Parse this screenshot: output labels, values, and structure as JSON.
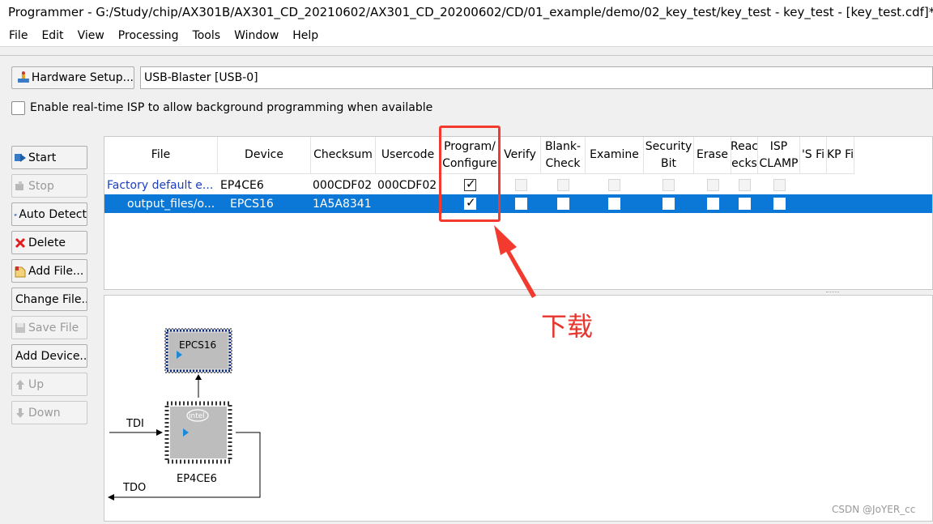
{
  "window": {
    "title": "Programmer - G:/Study/chip/AX301B/AX301_CD_20210602/AX301_CD_20200602/CD/01_example/demo/02_key_test/key_test - key_test - [key_test.cdf]*"
  },
  "menu": [
    "File",
    "Edit",
    "View",
    "Processing",
    "Tools",
    "Window",
    "Help"
  ],
  "hardware": {
    "setup_label": "Hardware Setup...",
    "selected": "USB-Blaster [USB-0]"
  },
  "isp": {
    "label": "Enable real-time ISP to allow background programming when available",
    "checked": false
  },
  "sidebar": {
    "start": "Start",
    "stop": "Stop",
    "auto_detect": "Auto Detect",
    "delete": "Delete",
    "add_file": "Add File...",
    "change_file": "Change File...",
    "save_file": "Save File",
    "add_device": "Add Device...",
    "up": "Up",
    "down": "Down"
  },
  "grid": {
    "columns": [
      "File",
      "Device",
      "Checksum",
      "Usercode",
      "Program/\nConfigure",
      "Verify",
      "Blank-\nCheck",
      "Examine",
      "Security\nBit",
      "Erase",
      "Reac\necks",
      "ISP\nCLAMP",
      "'S Fi",
      "KP Fi"
    ],
    "rows": [
      {
        "file": "Factory default e...",
        "device": "EP4CE6",
        "checksum": "000CDF02",
        "usercode": "000CDF02",
        "program": true
      },
      {
        "file": "output_files/o...",
        "device": "EPCS16",
        "checksum": "1A5A8341",
        "usercode": "",
        "program": true
      }
    ]
  },
  "diagram": {
    "flash_label": "EPCS16",
    "fpga_label": "EP4CE6",
    "fpga_logo": "intel",
    "tdi": "TDI",
    "tdo": "TDO"
  },
  "annotation": {
    "text": "下载",
    "color": "#e8342c"
  },
  "watermark": "CSDN @JoYER_cc"
}
